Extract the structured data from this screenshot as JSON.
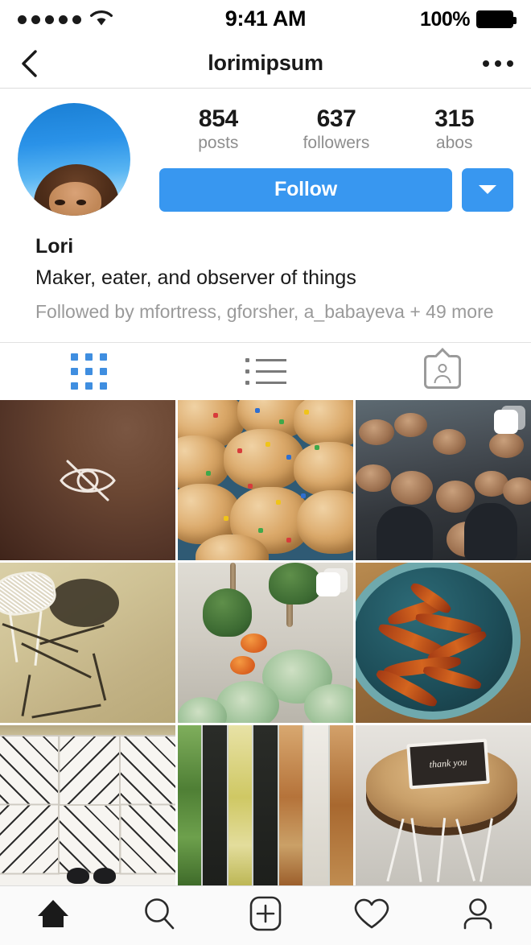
{
  "status_bar": {
    "signal_dots": 5,
    "wifi_icon": "wifi-icon",
    "time": "9:41 AM",
    "battery_percent": "100%",
    "battery_icon": "battery-full-icon"
  },
  "nav_bar": {
    "back_icon": "chevron-left-icon",
    "title": "lorimipsum",
    "more_icon": "ellipsis-icon"
  },
  "profile": {
    "avatar_alt": "profile-photo",
    "stats": [
      {
        "value": "854",
        "label": "posts"
      },
      {
        "value": "637",
        "label": "followers"
      },
      {
        "value": "315",
        "label": "abos"
      }
    ],
    "follow_button": "Follow",
    "dropdown_icon": "chevron-down-icon",
    "accent_color": "#3897f0",
    "name": "Lori",
    "bio": "Maker, eater, and observer of things",
    "followed_by": "Followed by mfortress, gforsher, a_babayeva + 49 more"
  },
  "tabs": [
    {
      "name": "grid-tab",
      "icon": "grid-icon",
      "active": true,
      "color": "#3f8ee0"
    },
    {
      "name": "list-tab",
      "icon": "list-icon",
      "active": false,
      "color": "#7a7a7a"
    },
    {
      "name": "tagged-tab",
      "icon": "tagged-person-card-icon",
      "active": false,
      "color": "#9a9a9a"
    }
  ],
  "grid_posts": [
    {
      "id": 1,
      "alt": "hidden-post",
      "badge": "hidden-eye-icon"
    },
    {
      "id": 2,
      "alt": "donut-holes-with-sprinkles",
      "badge": null
    },
    {
      "id": 3,
      "alt": "group-selfie",
      "badge": "multiple-photos-icon"
    },
    {
      "id": 4,
      "alt": "wire-chair-shadow-on-sand",
      "badge": null
    },
    {
      "id": 5,
      "alt": "succulent-plants",
      "badge": "multiple-photos-icon"
    },
    {
      "id": 6,
      "alt": "bowl-of-braised-food",
      "badge": null
    },
    {
      "id": 7,
      "alt": "geometric-tile-floor-with-shoes",
      "badge": null
    },
    {
      "id": 8,
      "alt": "packed-food-bags",
      "badge": null
    },
    {
      "id": 9,
      "alt": "wood-slice-table-with-thank-you-card",
      "badge": null,
      "card_text": "thank you"
    }
  ],
  "bottom_nav": [
    {
      "name": "home-tab",
      "icon": "home-icon",
      "active": true
    },
    {
      "name": "search-tab",
      "icon": "search-icon",
      "active": false
    },
    {
      "name": "new-post-tab",
      "icon": "plus-square-icon",
      "active": false
    },
    {
      "name": "activity-tab",
      "icon": "heart-icon",
      "active": false
    },
    {
      "name": "profile-tab",
      "icon": "person-icon",
      "active": false
    }
  ]
}
